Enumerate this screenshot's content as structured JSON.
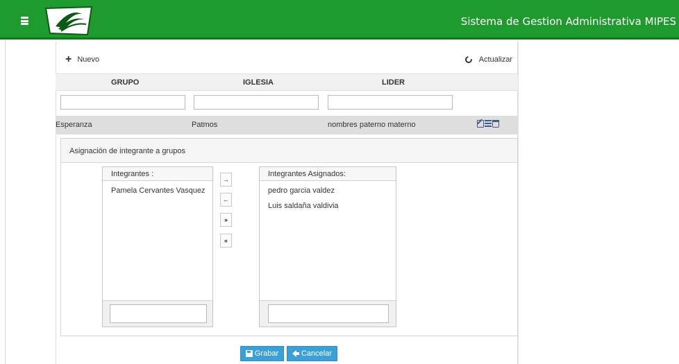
{
  "header": {
    "system_title": "Sistema de Gestion Administrativa MIPES",
    "menu_icon": "list-icon",
    "logo_icon": "mipes-logo-icon",
    "brand_color": "#1f9a2e"
  },
  "toolbar": {
    "nuevo_label": "Nuevo",
    "nuevo_icon": "plus-icon",
    "actualizar_label": "Actualizar",
    "actualizar_icon": "refresh-icon"
  },
  "table": {
    "columns": [
      "GRUPO",
      "IGLESIA",
      "LIDER"
    ],
    "filters": [
      "",
      "",
      ""
    ],
    "rows": [
      {
        "grupo": "Esperanza",
        "iglesia": "Patmos",
        "lider": "nombres  paterno materno",
        "actions": [
          "edit-icon",
          "list-icon",
          "trash-icon"
        ]
      }
    ]
  },
  "assign": {
    "title": "Asignación de integrante a grupos",
    "left_list": {
      "header": "Integrantes :",
      "items": [
        "Pamela Cervantes Vasquez"
      ],
      "search_value": ""
    },
    "right_list": {
      "header": "Integrantes Asignados:",
      "items": [
        "pedro garcia valdez",
        "Luis saldaña valdivia"
      ],
      "search_value": ""
    },
    "move_buttons": [
      "→",
      "←",
      "»",
      "«"
    ]
  },
  "actions": {
    "grabar_label": "Grabar",
    "grabar_icon": "save-icon",
    "cancelar_label": "Cancelar",
    "cancelar_icon": "arrow-left-icon",
    "button_color": "#3aa0d5"
  }
}
